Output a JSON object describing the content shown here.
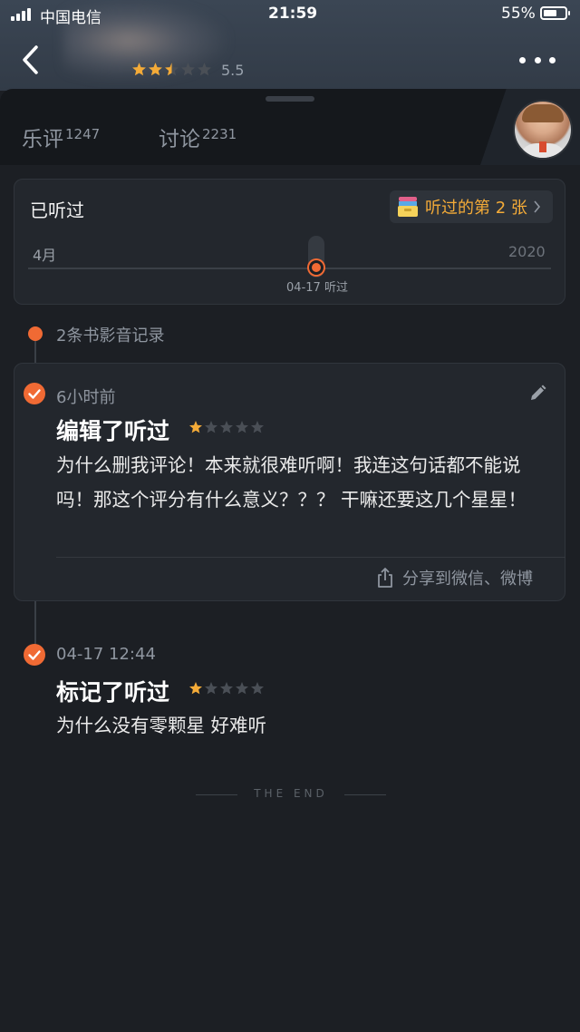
{
  "status_bar": {
    "carrier": "中国电信",
    "time": "21:59",
    "battery": "55%"
  },
  "header": {
    "rating": 5.5,
    "rating_text": "5.5",
    "stars_filled": 2.5,
    "stars_total": 5
  },
  "tabs": [
    {
      "label": "乐评",
      "count": "1247"
    },
    {
      "label": "讨论",
      "count": "2231"
    }
  ],
  "listened_card": {
    "title": "已听过",
    "nth_badge": "听过的第 2 张",
    "month": "4月",
    "year": "2020",
    "marker_date": "04-17 听过"
  },
  "records": {
    "count_label": "2条书影音记录",
    "items": [
      {
        "time": "6小时前",
        "action": "编辑了听过",
        "stars": 1,
        "body": "为什么删我评论！本来就很难听啊！我连这句话都不能说吗！那这个评分有什么意义？？？ 干嘛还要这几个星星！",
        "share_label": "分享到微信、微博"
      },
      {
        "time": "04-17 12:44",
        "action": "标记了听过",
        "stars": 1,
        "body": "为什么没有零颗星 好难听"
      }
    ]
  },
  "footer": {
    "end_text": "THE END"
  },
  "colors": {
    "accent": "#f06a34",
    "star_filled": "#f4ab38",
    "star_empty": "#4a4f56",
    "badge_text": "#f4ab38"
  }
}
